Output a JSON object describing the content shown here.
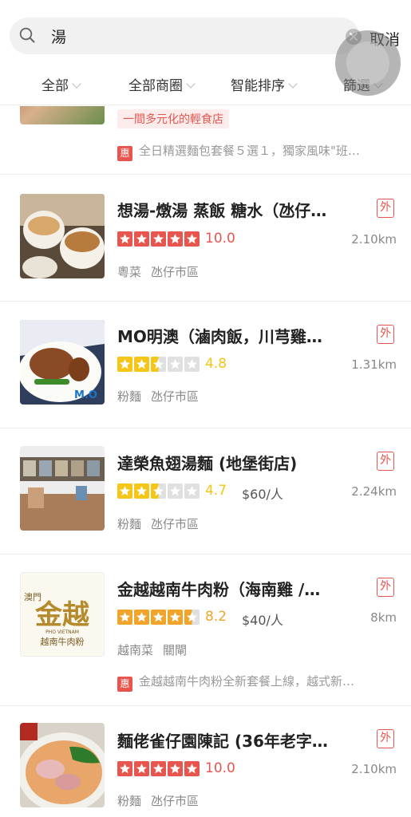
{
  "search": {
    "query": "湯",
    "cancel_label": "取消"
  },
  "filters": [
    "全部",
    "全部商圈",
    "智能排序",
    "篩選"
  ],
  "colors": {
    "red": "#e8554e",
    "gold": "#f5c518",
    "grey_star": "#e0e0e0"
  },
  "partial_card": {
    "slogan": "一間多元化的輕食店",
    "promo_badge": "惠",
    "promo_text": "全日精選麵包套餐５選１，獨家風味\"班…"
  },
  "restaurants": [
    {
      "name": "想湯-燉湯 蒸飯 糖水（氹仔…",
      "badge": "外",
      "rating": 5,
      "score": "10.0",
      "price": "",
      "distance": "2.10km",
      "cuisine": "粵菜",
      "area": "氹仔市區",
      "promo_badge": "",
      "promo_text": "",
      "thumb_icon": "soup-pots-photo"
    },
    {
      "name": "MO明澳（滷肉飯，川芎雞…",
      "badge": "外",
      "rating": 2.5,
      "score": "4.8",
      "price": "",
      "distance": "1.31km",
      "cuisine": "粉麵",
      "area": "氹仔市區",
      "promo_badge": "",
      "promo_text": "",
      "thumb_icon": "braised-pork-rice-photo"
    },
    {
      "name": "達榮魚翅湯麵 (地堡街店)",
      "badge": "外",
      "rating": 2.5,
      "score": "4.7",
      "price": "$60/人",
      "distance": "2.24km",
      "cuisine": "粉麵",
      "area": "氹仔市區",
      "promo_badge": "",
      "promo_text": "",
      "thumb_icon": "restaurant-interior-photo"
    },
    {
      "name": "金越越南牛肉粉（海南雞 /…",
      "badge": "外",
      "rating": 4.5,
      "score": "8.2",
      "price": "$40/人",
      "distance": "8km",
      "cuisine": "越南菜",
      "area": "關閘",
      "promo_badge": "惠",
      "promo_text": "金越越南牛肉粉全新套餐上線，越式新…",
      "thumb_icon": "kim-viet-logo",
      "logo_text": "金越",
      "logo_sub": "越南牛肉粉",
      "logo_top": "澳門",
      "logo_en": "PHO VIETNAM"
    },
    {
      "name": "麵佬雀仔園陳記 (36年老字…",
      "badge": "外",
      "rating": 5,
      "score": "10.0",
      "price": "",
      "distance": "2.10km",
      "cuisine": "粉麵",
      "area": "氹仔市區",
      "promo_badge": "",
      "promo_text": "",
      "thumb_icon": "noodle-bowl-photo"
    }
  ]
}
